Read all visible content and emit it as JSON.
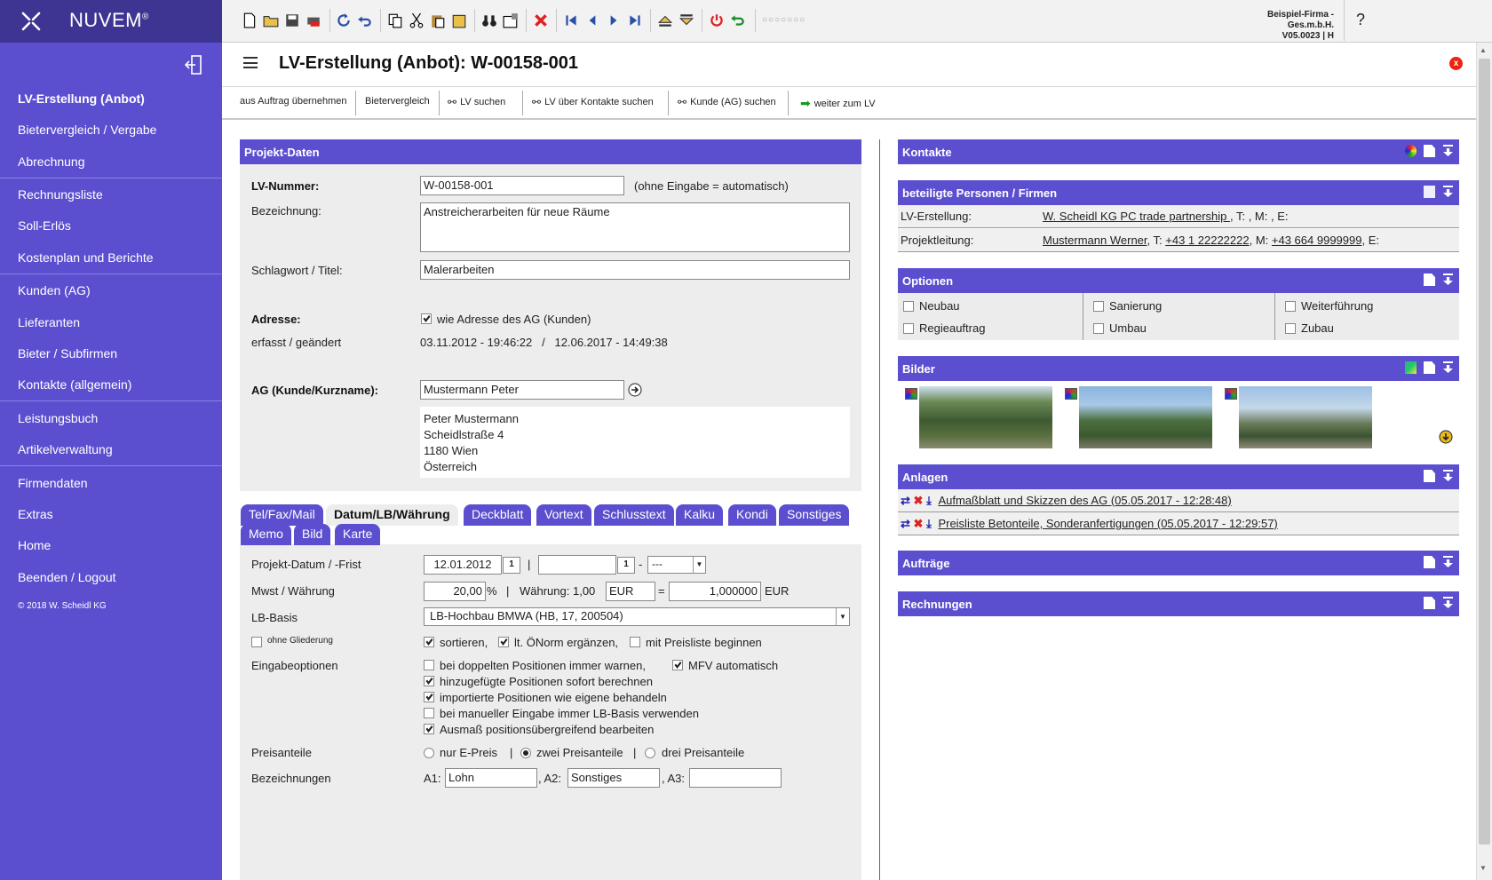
{
  "app": {
    "name": "NUVEM",
    "reg": "®",
    "copyright": "© 2018 W. Scheidl KG"
  },
  "company": {
    "name": "Beispiel-Firma - Ges.m.b.H.",
    "version": "V05.0023 | H"
  },
  "sidebar": {
    "items": [
      {
        "label": "LV-Erstellung (Anbot)"
      },
      {
        "label": "Bietervergleich / Vergabe"
      },
      {
        "label": "Abrechnung"
      },
      {
        "label": "Rechnungsliste"
      },
      {
        "label": "Soll-Erlös"
      },
      {
        "label": "Kostenplan und Berichte"
      },
      {
        "label": "Kunden (AG)"
      },
      {
        "label": "Lieferanten"
      },
      {
        "label": "Bieter / Subfirmen"
      },
      {
        "label": "Kontakte (allgemein)"
      },
      {
        "label": "Leistungsbuch"
      },
      {
        "label": "Artikelverwaltung"
      },
      {
        "label": "Firmendaten"
      },
      {
        "label": "Extras"
      },
      {
        "label": "Home"
      },
      {
        "label": "Beenden / Logout"
      }
    ]
  },
  "page": {
    "title": "LV-Erstellung (Anbot): W-00158-001",
    "help": "?"
  },
  "toolbar": {
    "buttons": [
      "aus Auftrag übernehmen",
      "Bietervergleich",
      "LV suchen",
      "LV über Kontakte suchen",
      "Kunde (AG) suchen",
      "weiter zum LV"
    ]
  },
  "projekt": {
    "header": "Projekt-Daten",
    "lv_label": "LV-Nummer:",
    "lv_value": "W-00158-001",
    "lv_hint": "(ohne Eingabe = automatisch)",
    "bez_label": "Bezeichnung:",
    "bez_value": "Anstreicherarbeiten für neue Räume",
    "schlag_label": "Schlagwort / Titel:",
    "schlag_value": "Malerarbeiten",
    "adresse_label": "Adresse:",
    "adresse_cb": "wie Adresse des AG (Kunden)",
    "erfasst_label": "erfasst / geändert",
    "erfasst_value": "03.11.2012 - 19:46:22   /   12.06.2017 - 14:49:38",
    "ag_label": "AG (Kunde/Kurzname):",
    "ag_value": "Mustermann Peter",
    "addr": [
      "Peter Mustermann",
      "Scheidlstraße 4",
      "1180 Wien",
      "Österreich"
    ]
  },
  "tabs": {
    "row1": [
      "Tel/Fax/Mail",
      "Datum/LB/Währung",
      "Deckblatt",
      "Vortext",
      "Schlusstext",
      "Kalku",
      "Kondi",
      "Sonstiges"
    ],
    "row2": [
      "Memo",
      "Bild",
      "Karte"
    ],
    "active": "Datum/LB/Währung"
  },
  "datum": {
    "frist_label": "Projekt-Datum / -Frist",
    "frist_date": "12.01.2012",
    "frist_cal": "1",
    "frist_cal2": "1",
    "frist_sel": "---",
    "mwst_label": "Mwst / Währung",
    "mwst_value": "20,00",
    "waehrung_text": "Währung: 1,00",
    "waehrung_code": "EUR",
    "kurs": "1,000000",
    "kurs_code": "EUR",
    "lb_label": "LB-Basis",
    "lb_value": "LB-Hochbau BMWA (HB, 17, 200504)",
    "ohne_gliederung": "ohne Gliederung",
    "sortieren": "sortieren,",
    "oenorm": "lt. ÖNorm ergänzen,",
    "preisliste": "mit Preisliste beginnen",
    "eingabe_label": "Eingabeoptionen",
    "opt1": "bei doppelten Positionen immer warnen,",
    "opt1b": "MFV automatisch",
    "opt2": "hinzugefügte Positionen sofort berechnen",
    "opt3": "importierte Positionen wie eigene behandeln",
    "opt4": "bei manueller Eingabe immer LB-Basis verwenden",
    "opt5": "Ausmaß positionsübergreifend bearbeiten",
    "preis_label": "Preisanteile",
    "preis_opts": [
      "nur E-Preis",
      "zwei Preisanteile",
      "drei Preisanteile"
    ],
    "bez_label": "Bezeichnungen",
    "a1_label": "A1:",
    "a1": "Lohn",
    "a2_label": ", A2:",
    "a2": "Sonstiges",
    "a3_label": ", A3:",
    "a3": ""
  },
  "right": {
    "kontakte": "Kontakte",
    "beteiligte": "beteiligte Personen / Firmen",
    "lv_erstellung_label": "LV-Erstellung:",
    "lv_erstellung_name": "W. Scheidl KG PC trade partnership ",
    "lv_erstellung_rest": ", T: , M: , E:",
    "projektleitung_label": "Projektleitung:",
    "pl_name": "Mustermann Werner",
    "pl_t": ", T: ",
    "pl_tel": "+43 1 22222222",
    "pl_m": ", M: ",
    "pl_mob": "+43 664 9999999",
    "pl_e": ", E:",
    "optionen": "Optionen",
    "options": [
      {
        "label": "Neubau",
        "checked": false
      },
      {
        "label": "Sanierung",
        "checked": false
      },
      {
        "label": "Weiterführung",
        "checked": false
      },
      {
        "label": "Regieauftrag",
        "checked": false
      },
      {
        "label": "Umbau",
        "checked": false
      },
      {
        "label": "Zubau",
        "checked": false
      }
    ],
    "bilder": "Bilder",
    "anlagen": "Anlagen",
    "anlage1": "Aufmaßblatt und Skizzen des AG (05.05.2017 - 12:28:48)",
    "anlage2": "Preisliste Betonteile, Sonderanfertigungen (05.05.2017 - 12:29:57)",
    "auftraege": "Aufträge",
    "rechnungen": "Rechnungen"
  },
  "colors": {
    "accent": "#5b4fcf",
    "logo_bg": "#3e3593"
  }
}
